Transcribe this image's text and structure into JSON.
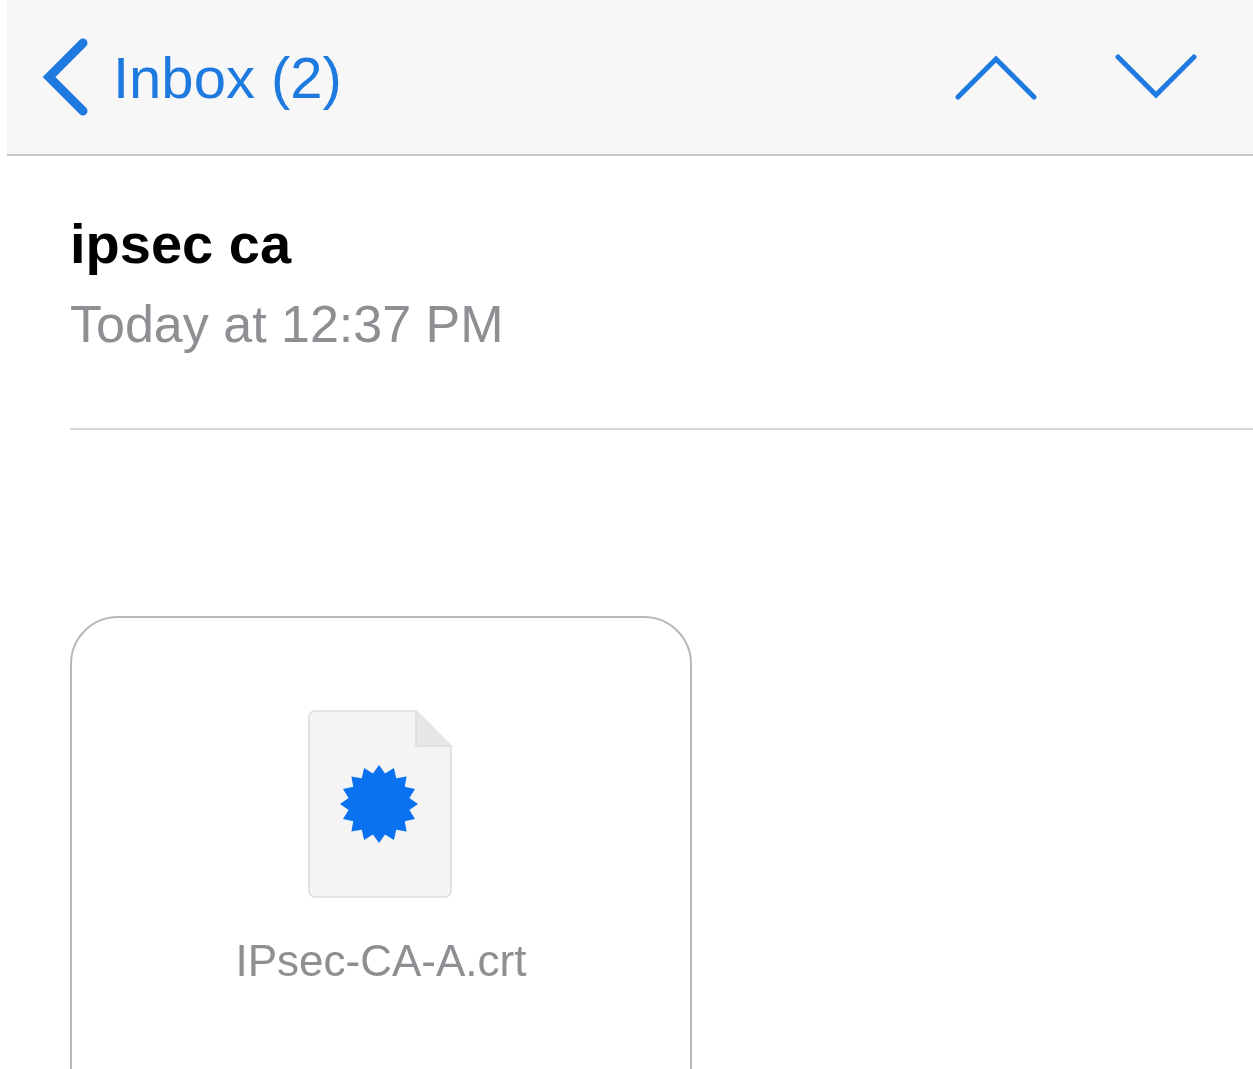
{
  "nav_bar": {
    "back_label": "Inbox (2)"
  },
  "message": {
    "sender": "ipsec ca",
    "date": "Today at 12:37 PM"
  },
  "attachments": [
    {
      "filename": "IPsec-CA-A.crt"
    }
  ]
}
